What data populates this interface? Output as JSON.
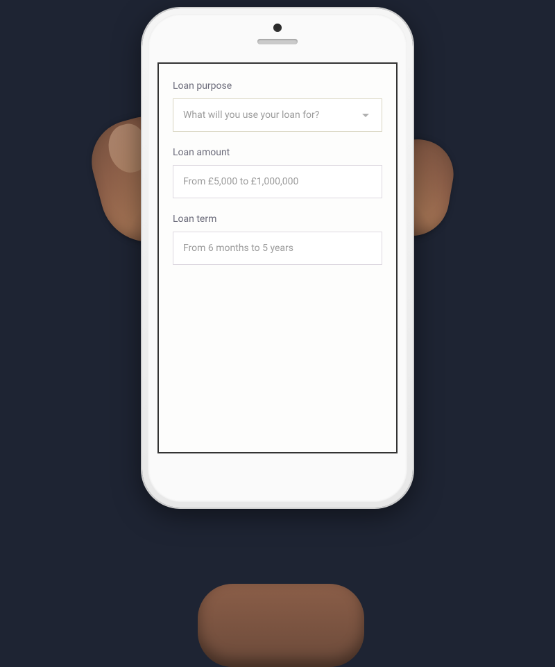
{
  "form": {
    "loanPurpose": {
      "label": "Loan purpose",
      "placeholder": "What will you use your loan for?"
    },
    "loanAmount": {
      "label": "Loan amount",
      "placeholder": "From £5,000 to £1,000,000"
    },
    "loanTerm": {
      "label": "Loan term",
      "placeholder": "From 6 months to 5 years"
    }
  }
}
